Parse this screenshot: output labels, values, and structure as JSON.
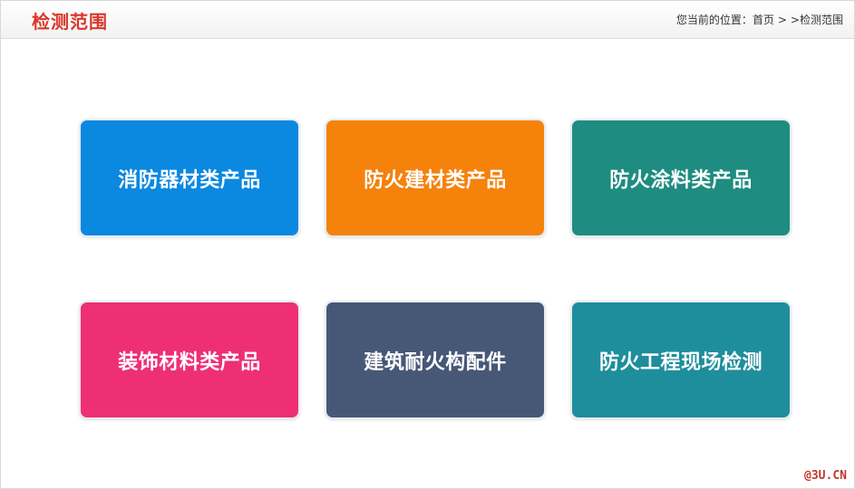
{
  "header": {
    "title": "检测范围",
    "title_color": "#d9372b"
  },
  "breadcrumb": {
    "prefix": "您当前的位置：",
    "home": "首页",
    "sep1": ">",
    "sep2": ">",
    "current": "检测范围"
  },
  "categories": [
    {
      "label": "消防器材类产品",
      "color": "#0b88e0"
    },
    {
      "label": "防火建材类产品",
      "color": "#f5820b"
    },
    {
      "label": "防火涂料类产品",
      "color": "#1e8c80"
    },
    {
      "label": "装饰材料类产品",
      "color": "#ee2f74"
    },
    {
      "label": "建筑耐火构配件",
      "color": "#475776"
    },
    {
      "label": "防火工程现场检测",
      "color": "#1f8e9c"
    }
  ],
  "watermark": "@3U.CN"
}
